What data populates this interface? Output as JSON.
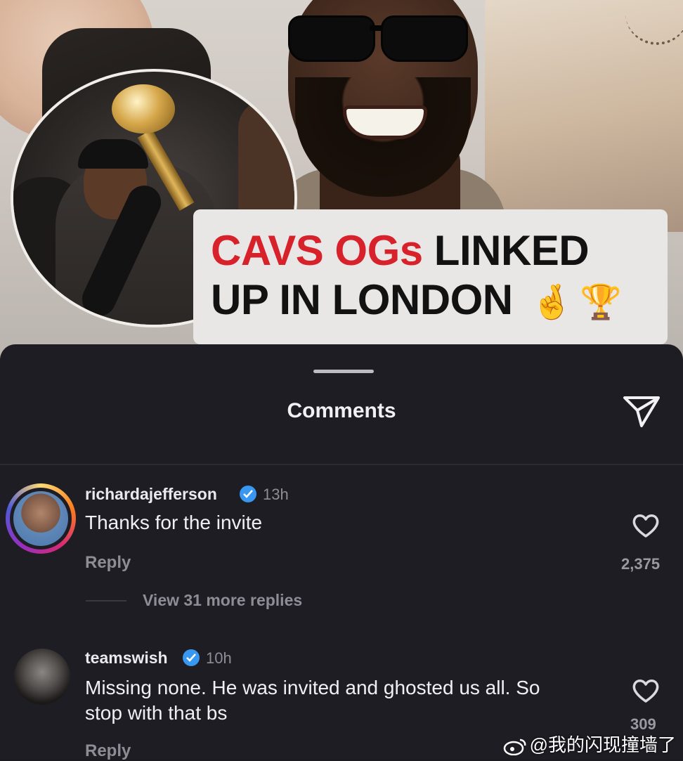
{
  "post": {
    "headline_red": "CAVS OGs",
    "headline_rest_line1": "LINKED",
    "headline_line2": "UP IN LONDON",
    "emoji_fingers": "🤞",
    "emoji_trophy": "🏆"
  },
  "sheet": {
    "title": "Comments",
    "share_icon": "send-icon"
  },
  "comments": [
    {
      "username": "richardajefferson",
      "verified": true,
      "time": "13h",
      "text": "Thanks for the invite",
      "reply_label": "Reply",
      "likes": "2,375",
      "view_more": "View 31 more replies"
    },
    {
      "username": "teamswish",
      "verified": true,
      "time": "10h",
      "text_line1": "Missing none. He was invited and ghosted us all. So",
      "text_line2": "stop with that bs",
      "reply_label": "Reply",
      "likes": "309"
    }
  ],
  "watermark": "@我的闪现撞墙了",
  "colors": {
    "sheet_bg": "#1e1d24",
    "headline_red": "#d8222b",
    "verified_blue": "#3897f0"
  }
}
